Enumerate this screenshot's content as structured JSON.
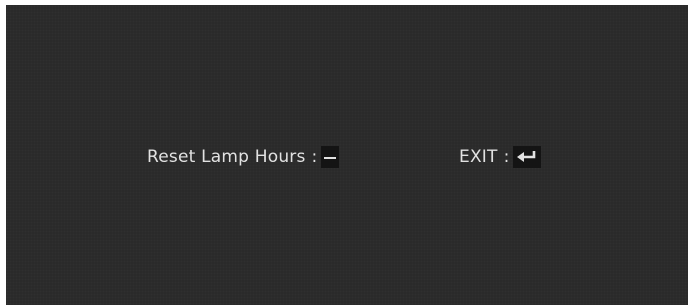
{
  "osd": {
    "reset_label": "Reset Lamp Hours",
    "reset_separator": ":",
    "reset_key_icon": "dash-icon",
    "exit_label": "EXIT",
    "exit_separator": ":",
    "exit_key_icon": "enter-return-icon"
  },
  "colors": {
    "background": "#2a2a2a",
    "text": "#e2e2e2",
    "key_box": "#141414"
  }
}
